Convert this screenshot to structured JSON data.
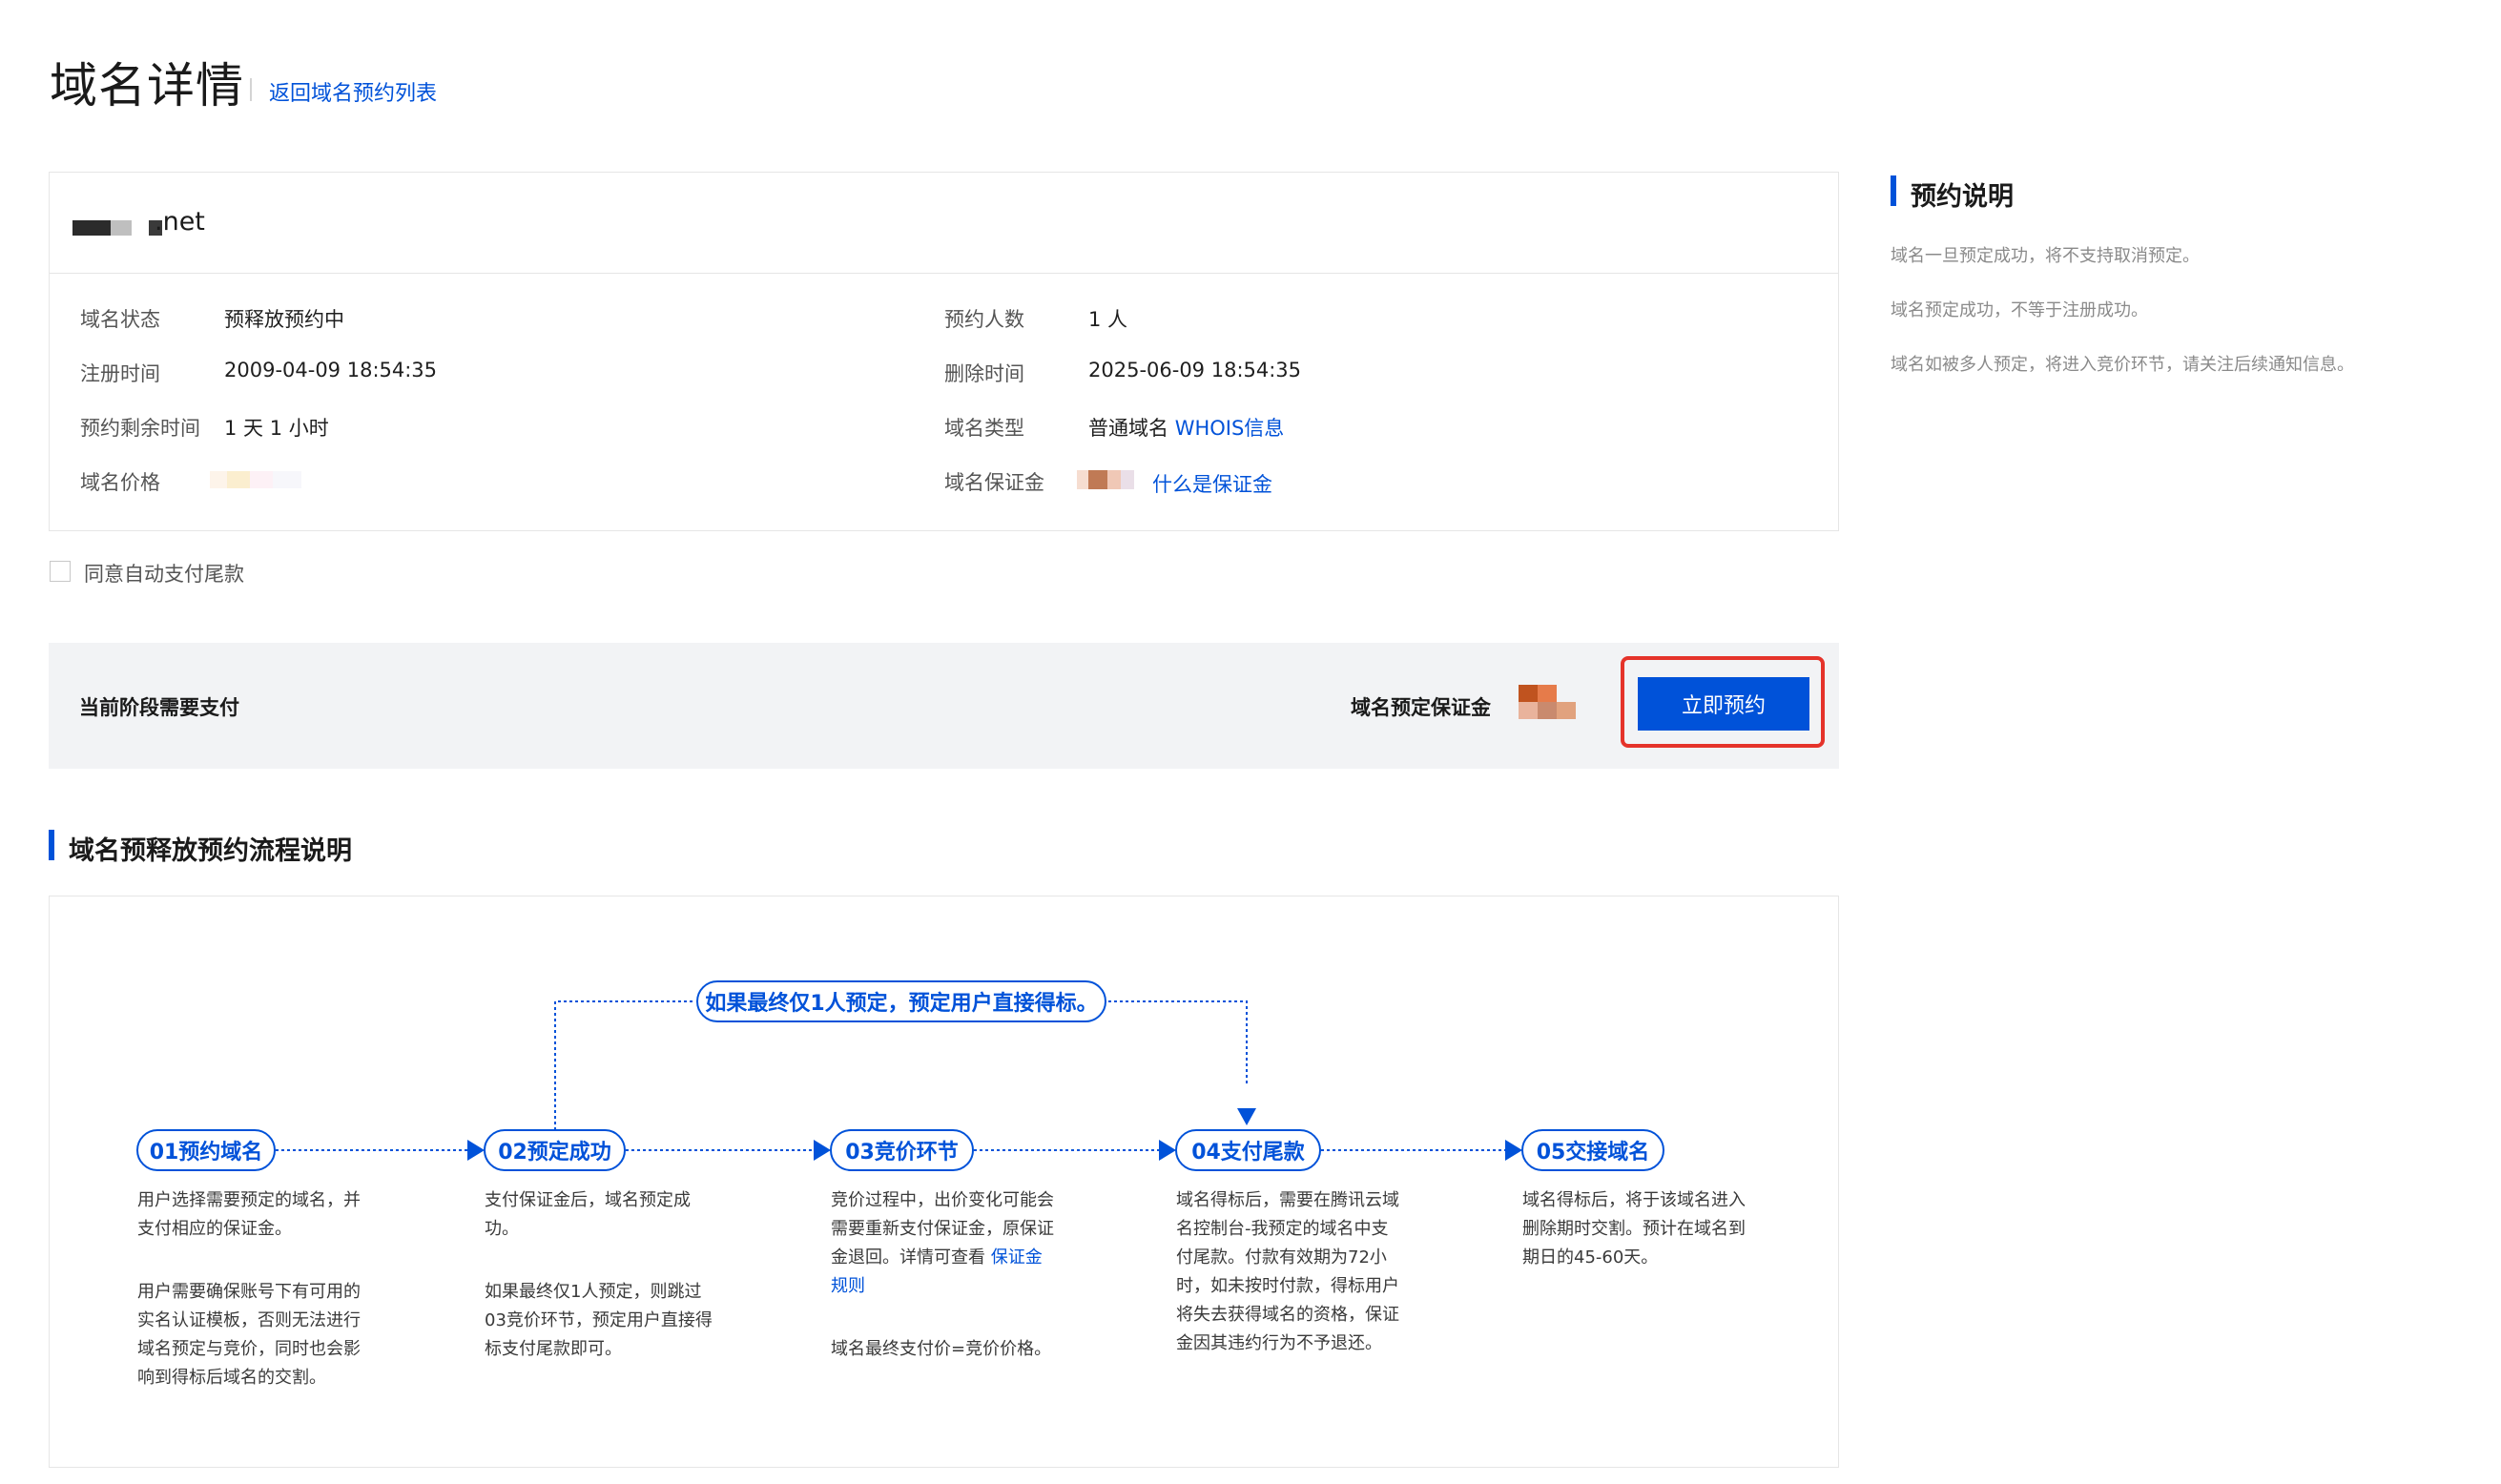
{
  "header": {
    "title": "域名详情",
    "back_link": "返回域名预约列表"
  },
  "domain": {
    "name_suffix": ".net",
    "fields": {
      "status_label": "域名状态",
      "status_value": "预释放预约中",
      "reservers_label": "预约人数",
      "reservers_value": "1 人",
      "reg_time_label": "注册时间",
      "reg_time_value": "2009-04-09 18:54:35",
      "del_time_label": "删除时间",
      "del_time_value": "2025-06-09 18:54:35",
      "remaining_label": "预约剩余时间",
      "remaining_value": "1 天 1 小时",
      "type_label": "域名类型",
      "type_value": "普通域名",
      "whois_link": "WHOIS信息",
      "price_label": "域名价格",
      "deposit_label": "域名保证金",
      "deposit_link": "什么是保证金"
    }
  },
  "autopay": {
    "label": "同意自动支付尾款",
    "checked": false
  },
  "payment": {
    "stage_label": "当前阶段需要支付",
    "deposit_label": "域名预定保证金",
    "reserve_button": "立即预约"
  },
  "flow": {
    "title": "域名预释放预约流程说明",
    "shortcut_note": "如果最终仅1人预定，预定用户直接得标。",
    "steps": [
      {
        "label": "01预约域名",
        "desc": [
          "用户选择需要预定的域名，并",
          "支付相应的保证金。",
          "",
          "用户需要确保账号下有可用的",
          "实名认证模板，否则无法进行",
          "域名预定与竞价，同时也会影",
          "响到得标后域名的交割。"
        ]
      },
      {
        "label": "02预定成功",
        "desc": [
          "支付保证金后，域名预定成",
          "功。",
          "",
          "如果最终仅1人预定，则跳过",
          "03竞价环节，预定用户直接得",
          "标支付尾款即可。"
        ]
      },
      {
        "label": "03竞价环节",
        "desc_lines": [
          "竞价过程中，出价变化可能会",
          "需要重新支付保证金，原保证",
          "金退回。详情可查看 "
        ],
        "desc_link1": "保证金",
        "desc_link2": "规则",
        "desc_after": "域名最终支付价=竞价价格。"
      },
      {
        "label": "04支付尾款",
        "desc": [
          "域名得标后，需要在腾讯云域",
          "名控制台-我预定的域名中支",
          "付尾款。付款有效期为72小",
          "时，如未按时付款，得标用户",
          "将失去获得域名的资格，保证",
          "金因其违约行为不予退还。"
        ]
      },
      {
        "label": "05交接域名",
        "desc": [
          "域名得标后，将于该域名进入",
          "删除期时交割。预计在域名到",
          "期日的45-60天。"
        ]
      }
    ]
  },
  "sidebar": {
    "title": "预约说明",
    "notes": [
      "域名一旦预定成功，将不支持取消预定。",
      "域名预定成功，不等于注册成功。",
      "域名如被多人预定，将进入竞价环节，请关注后续通知信息。"
    ]
  },
  "colors": {
    "accent": "#0052d9",
    "highlight": "#e5332a",
    "bar_bg": "#f2f3f5"
  }
}
